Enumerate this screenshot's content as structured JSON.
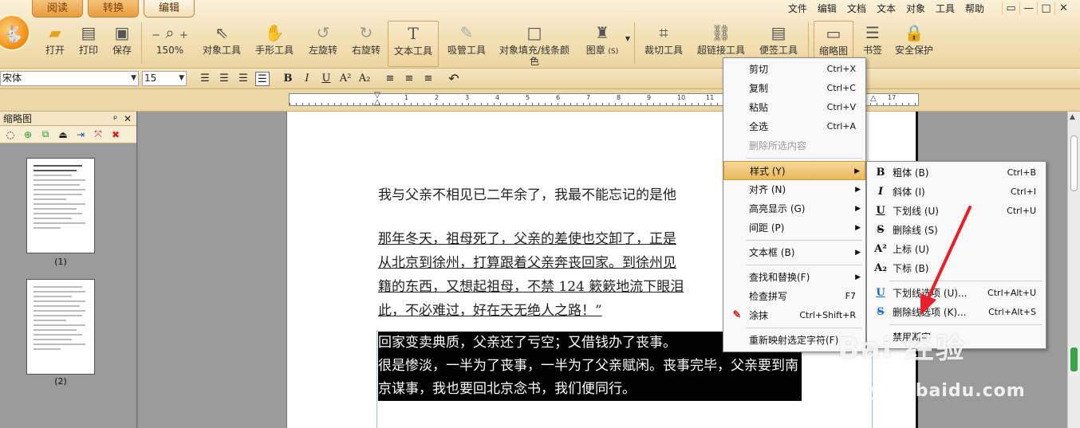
{
  "tabs": [
    "阅读",
    "转换",
    "编辑"
  ],
  "menubar": [
    "文件",
    "编辑",
    "文档",
    "文本",
    "对象",
    "工具",
    "帮助"
  ],
  "window_controls": [
    "▭",
    "—",
    "□",
    "✕"
  ],
  "toolbar": {
    "open": "打开",
    "print": "打印",
    "save": "保存",
    "zoom": "150%",
    "object_tool": "对象工具",
    "hand_tool": "手形工具",
    "rotate_left": "左旋转",
    "rotate_right": "右旋转",
    "text_tool": "文本工具",
    "eyedropper": "吸管工具",
    "fill_line_1": "对象填充/线条颜",
    "fill_line_2": "色",
    "stamp": "图章",
    "stamp_key": "(S)",
    "crop": "裁切工具",
    "link": "超链接工具",
    "note": "便签工具",
    "thumbnail": "缩略图",
    "bookmark": "书签",
    "security": "安全保护"
  },
  "format": {
    "font": "宋体",
    "size": "15"
  },
  "ruler_numbers": [
    "1",
    "2",
    "3",
    "4",
    "5",
    "6",
    "7",
    "8",
    "9",
    "10",
    "11",
    "12",
    "13",
    "14",
    "15",
    "16",
    "17"
  ],
  "side_panel": {
    "title": "缩略图",
    "pin": "ᵖ",
    "close": "✕",
    "pages": [
      "(1)",
      "(2)"
    ]
  },
  "document": {
    "p1": "我与父亲不相见已二年余了，我最不能忘记的是他",
    "p2": [
      "那年冬天，祖母死了，父亲的差使也交卸了，正是",
      "从北京到徐州，打算跟着父亲奔丧回家。到徐州见",
      "籍的东西，又想起祖母，不禁 124 簌簌地流下眼泪",
      "此，不必难过，好在天无绝人之路！”"
    ],
    "p3": [
      "回家变卖典质，父亲还了亏空；又借钱办了丧事。",
      "很是惨淡，一半为了丧事，一半为了父亲赋闲。丧事完毕，父亲要到南",
      "京谋事，我也要回北京念书，我们便同行。"
    ]
  },
  "context_menu": [
    {
      "label": "剪切",
      "shortcut": "Ctrl+X"
    },
    {
      "label": "复制",
      "shortcut": "Ctrl+C"
    },
    {
      "label": "粘贴",
      "shortcut": "Ctrl+V"
    },
    {
      "label": "全选",
      "shortcut": "Ctrl+A"
    },
    {
      "label": "删除所选内容",
      "shortcut": ""
    },
    {
      "label": "样式 (Y)",
      "shortcut": ""
    },
    {
      "label": "对齐 (N)",
      "shortcut": ""
    },
    {
      "label": "高亮显示 (G)",
      "shortcut": ""
    },
    {
      "label": "间距 (P)",
      "shortcut": ""
    },
    {
      "label": "文本框 (B)",
      "shortcut": ""
    },
    {
      "label": "查找和替换(F)",
      "shortcut": ""
    },
    {
      "label": "检查拼写",
      "shortcut": "F7"
    },
    {
      "label": "涂抹",
      "shortcut": "Ctrl+Shift+R"
    },
    {
      "label": "重新映射选定字符(F)",
      "shortcut": ""
    }
  ],
  "style_submenu": [
    {
      "label": "粗体 (B)",
      "shortcut": "Ctrl+B",
      "icon": "B"
    },
    {
      "label": "斜体 (I)",
      "shortcut": "Ctrl+I",
      "icon": "I"
    },
    {
      "label": "下划线 (U)",
      "shortcut": "Ctrl+U",
      "icon": "U"
    },
    {
      "label": "删除线 (S)",
      "shortcut": "",
      "icon": "S"
    },
    {
      "label": "上标 (U)",
      "shortcut": "",
      "icon": "A²"
    },
    {
      "label": "下标 (B)",
      "shortcut": "",
      "icon": "A₂"
    },
    {
      "label": "下划线选项 (U)...",
      "shortcut": "Ctrl+Alt+U",
      "icon": "U"
    },
    {
      "label": "删除线选项 (K)...",
      "shortcut": "Ctrl+Alt+S",
      "icon": "S"
    },
    {
      "label": "禁用断字",
      "shortcut": "",
      "icon": ""
    }
  ],
  "watermark": {
    "main": "Bai 经验",
    "sub": "jingyan.baidu.com"
  },
  "colors": {
    "highlight": "#000000",
    "menu_hot": "#eab85a",
    "arrow": "#e8202a"
  }
}
